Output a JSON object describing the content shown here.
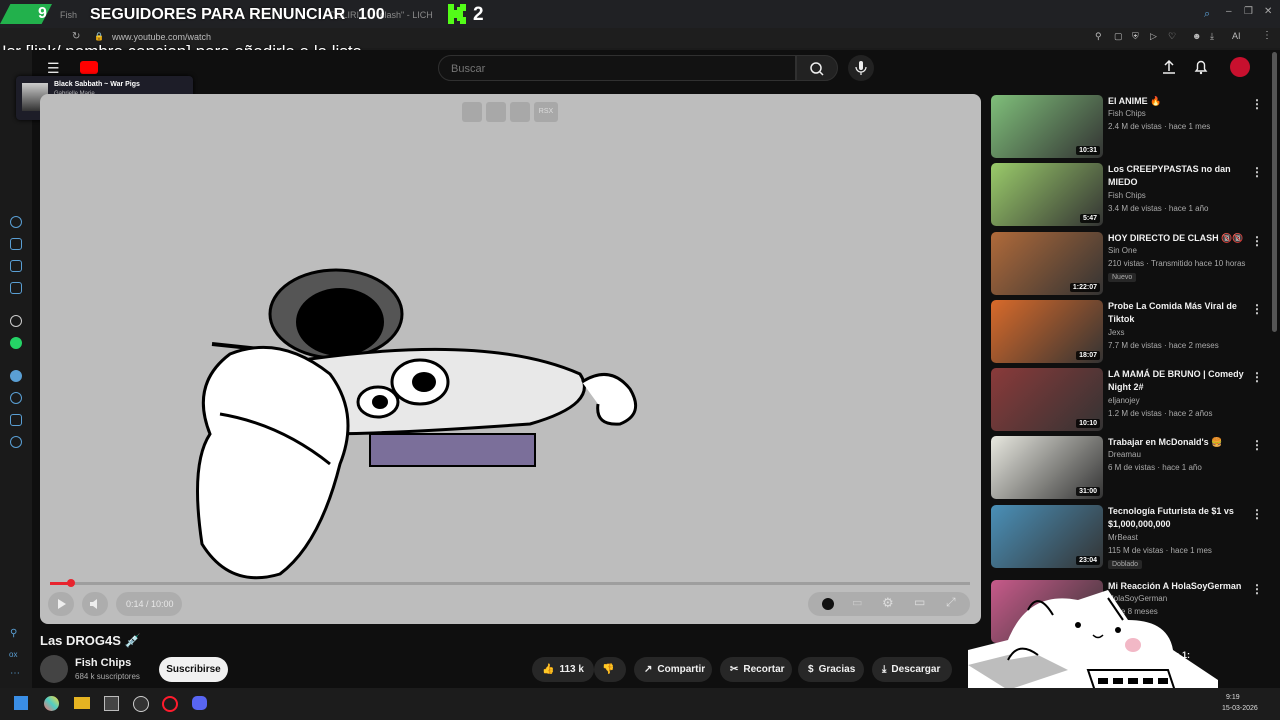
{
  "browser": {
    "url": "www.youtube.com/watch",
    "tab_text": "Fish",
    "tab_text2": "DELIRI",
    "tab_text3": "clash\" - LICH",
    "ai_label": "AI"
  },
  "overlay": {
    "follower_count": "9",
    "follower_goal_label": "SEGUIDORES PARA RENUNCIAR",
    "follower_goal_number": "100",
    "kick_count": "2",
    "sr_command": "!sr [link/ nombre cancion] para añadirla a la lista"
  },
  "music_widget": {
    "song": "Black Sabbath ~ War Pigs",
    "artist": "Gabrielle Marie"
  },
  "search": {
    "placeholder": "Buscar"
  },
  "player": {
    "time": "0:14 / 10:00",
    "progress": 0.023,
    "control_badge": "RSX"
  },
  "video": {
    "title": "Las DROG4S 💉",
    "channel": "Fish Chips",
    "subscribers": "684 k suscriptores",
    "subscribe_label": "Suscribirse",
    "likes": "113 k",
    "share_label": "Compartir",
    "clip_label": "Recortar",
    "thanks_label": "Gracias",
    "download_label": "Descargar"
  },
  "recommendations": [
    {
      "title": "El ANIME 🔥",
      "channel": "Fish Chips",
      "meta": "2.4 M de vistas · hace 1 mes",
      "duration": "10:31",
      "thumb_color": "#7fbf7a"
    },
    {
      "title": "Los CREEPYPASTAS no dan MIEDO",
      "channel": "Fish Chips",
      "meta": "3.4 M de vistas · hace 1 año",
      "duration": "5:47",
      "thumb_color": "#9acb6a"
    },
    {
      "title": "HOY DIRECTO DE CLASH 🔞🔞",
      "channel": "Sin One",
      "meta": "210 vistas · Transmitido hace 10 horas",
      "tag": "Nuevo",
      "duration": "1:22:07",
      "thumb_color": "#b06a3a"
    },
    {
      "title": "Probe La Comida Más Viral de Tiktok",
      "channel": "Jexs",
      "meta": "7.7 M de vistas · hace 2 meses",
      "duration": "18:07",
      "thumb_color": "#d86a2a"
    },
    {
      "title": "LA MAMÁ DE BRUNO | Comedy Night 2#",
      "channel": "eljanojey",
      "meta": "1.2 M de vistas · hace 2 años",
      "duration": "10:10",
      "thumb_color": "#8a3a3a"
    },
    {
      "title": "Trabajar en McDonald's 🍔",
      "channel": "Dreamau",
      "meta": "6 M de vistas · hace 1 año",
      "duration": "31:00",
      "thumb_color": "#e8e8e0"
    },
    {
      "title": "Tecnología Futurista de $1 vs $1,000,000,000",
      "channel": "MrBeast",
      "meta": "115 M de vistas · hace 1 mes",
      "tag": "Doblado",
      "duration": "23:04",
      "thumb_color": "#4a90b8"
    },
    {
      "title": "Mi Reacción A HolaSoyGerman",
      "channel": "HolaSoyGerman",
      "meta": "hace 8 meses",
      "duration": "",
      "thumb_color": "#c75a8a"
    }
  ],
  "partial_rec_text": "Ep 1:",
  "clock": {
    "time": "9:19",
    "date": "15-03-2026"
  },
  "colors": {
    "accent": "#e8242e",
    "kick_green": "#53fc18",
    "follow_green": "#22b14c"
  }
}
